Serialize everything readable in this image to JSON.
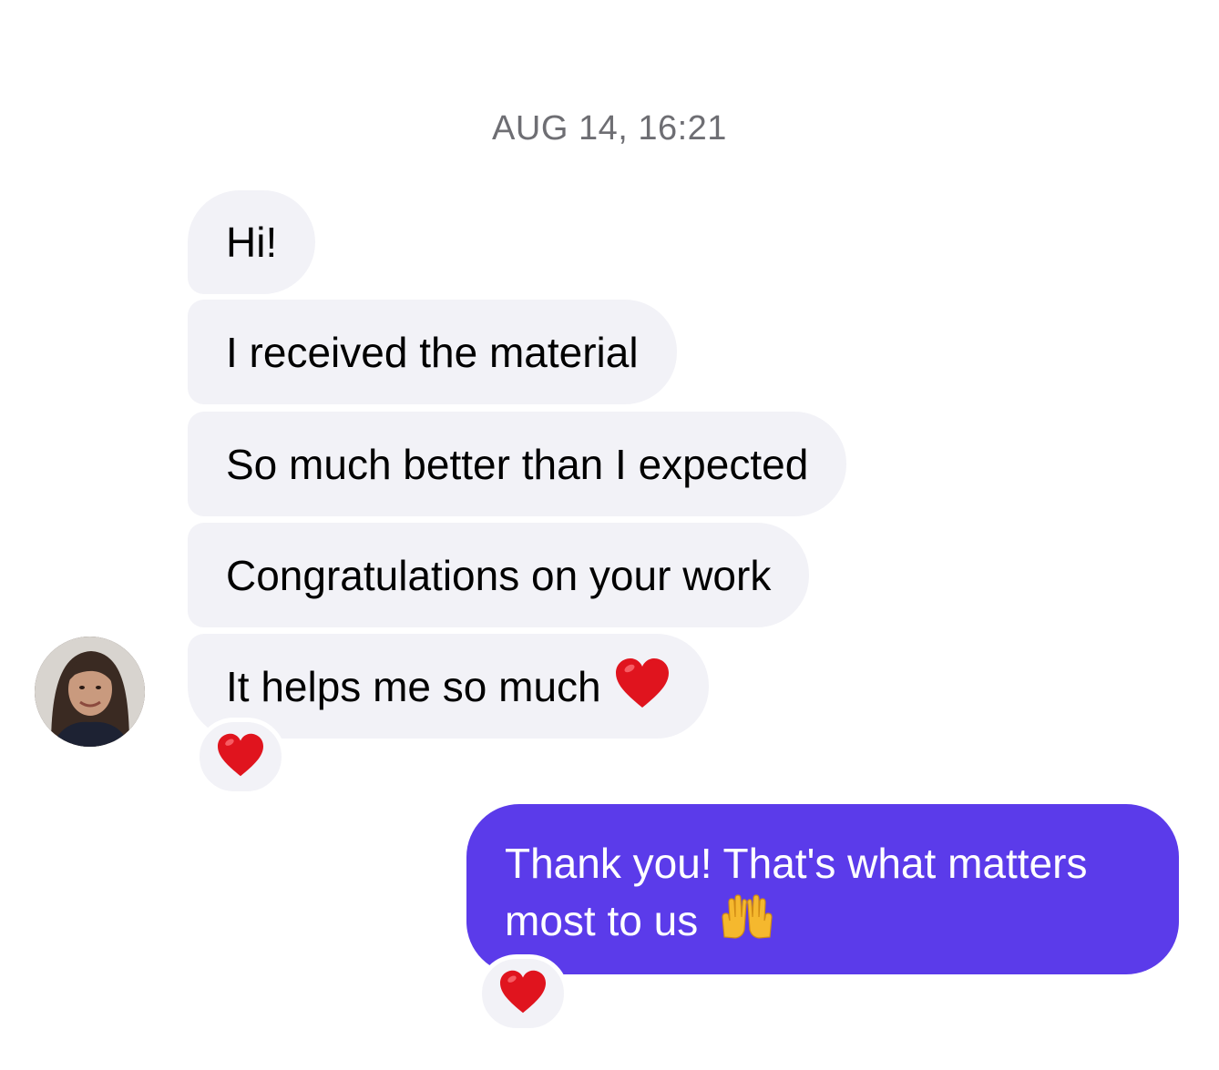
{
  "conversation": {
    "timestamp": "AUG 14, 16:21",
    "incoming": [
      {
        "text": "Hi!"
      },
      {
        "text": "I received the material"
      },
      {
        "text": "So much better than I expected"
      },
      {
        "text": "Congratulations on your work"
      },
      {
        "text": "It helps me so much"
      }
    ],
    "outgoing": {
      "line1": "Thank you! That's what matters",
      "line2": "most to us"
    },
    "reactions": {
      "incoming": "heart-icon",
      "outgoing": "heart-icon"
    }
  },
  "colors": {
    "incoming_bubble": "#f2f2f7",
    "outgoing_bubble": "#5b3bea",
    "heart": "#e0141e",
    "timestamp": "#6e6e73"
  },
  "icons": {
    "inline_emoji_1": "heart-icon",
    "inline_emoji_2": "raising-hands-icon"
  }
}
